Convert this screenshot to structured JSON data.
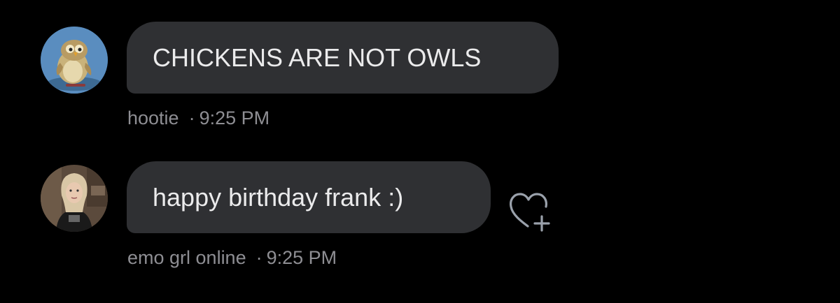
{
  "messages": [
    {
      "text": "CHICKENS ARE NOT OWLS",
      "sender": "hootie",
      "separator": "·",
      "time": "9:25 PM",
      "avatar": "owl-cartoon-avatar"
    },
    {
      "text": "happy birthday frank :)",
      "sender": "emo grl online",
      "separator": "·",
      "time": "9:25 PM",
      "avatar": "person-photo-avatar",
      "reaction_button": "heart-plus-icon"
    }
  ],
  "colors": {
    "background": "#000000",
    "bubble": "#2f3033",
    "message_text": "#ebebec",
    "meta_text": "#8e8e93",
    "icon_stroke": "#9aa1ab"
  }
}
